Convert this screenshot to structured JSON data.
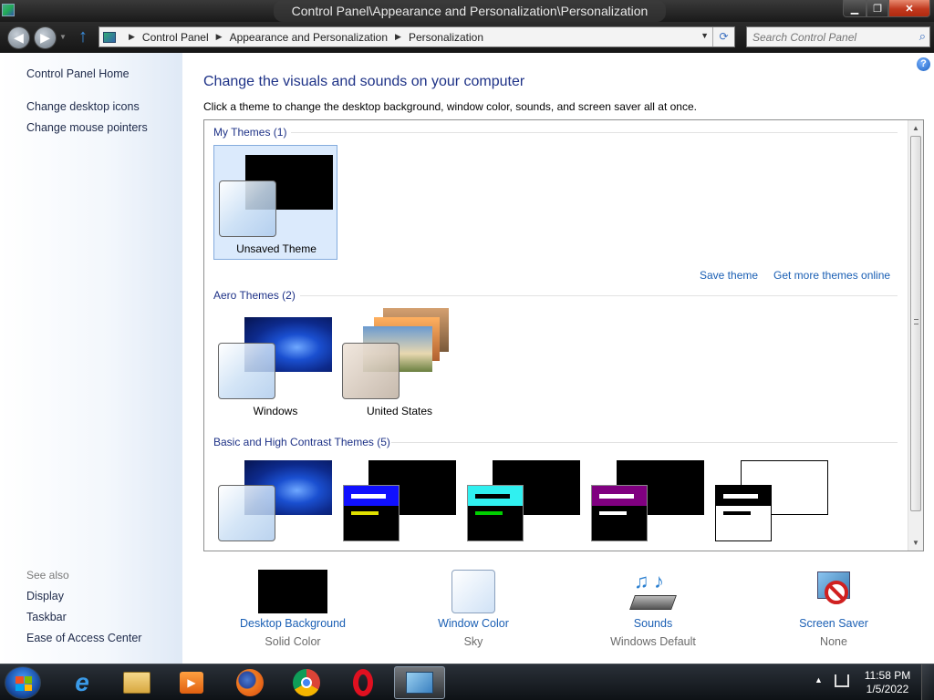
{
  "window": {
    "title": "Control Panel\\Appearance and Personalization\\Personalization"
  },
  "address": {
    "crumbs": [
      "Control Panel",
      "Appearance and Personalization",
      "Personalization"
    ],
    "search_placeholder": "Search Control Panel"
  },
  "sidebar": {
    "home": "Control Panel Home",
    "links": [
      "Change desktop icons",
      "Change mouse pointers"
    ],
    "see_also_label": "See also",
    "see_also": [
      "Display",
      "Taskbar",
      "Ease of Access Center"
    ]
  },
  "main": {
    "heading": "Change the visuals and sounds on your computer",
    "intro": "Click a theme to change the desktop background, window color, sounds, and screen saver all at once.",
    "groups": {
      "my": {
        "label": "My Themes (1)",
        "themes": [
          "Unsaved Theme"
        ]
      },
      "aero": {
        "label": "Aero Themes (2)",
        "themes": [
          "Windows",
          "United States"
        ]
      },
      "basic": {
        "label": "Basic and High Contrast Themes (5)"
      }
    },
    "save_theme": "Save theme",
    "get_more": "Get more themes online"
  },
  "bottom": [
    {
      "label": "Desktop Background",
      "value": "Solid Color"
    },
    {
      "label": "Window Color",
      "value": "Sky"
    },
    {
      "label": "Sounds",
      "value": "Windows Default"
    },
    {
      "label": "Screen Saver",
      "value": "None"
    }
  ],
  "taskbar": {
    "apps": [
      "internet-explorer-icon",
      "file-explorer-icon",
      "media-player-icon",
      "firefox-icon",
      "chrome-icon",
      "opera-icon",
      "control-panel-icon"
    ],
    "time": "11:58 PM",
    "date": "1/5/2022"
  },
  "colors": {
    "link": "#1a5fb4",
    "heading": "#1e3287",
    "selected_tile": "#dbeafc"
  }
}
